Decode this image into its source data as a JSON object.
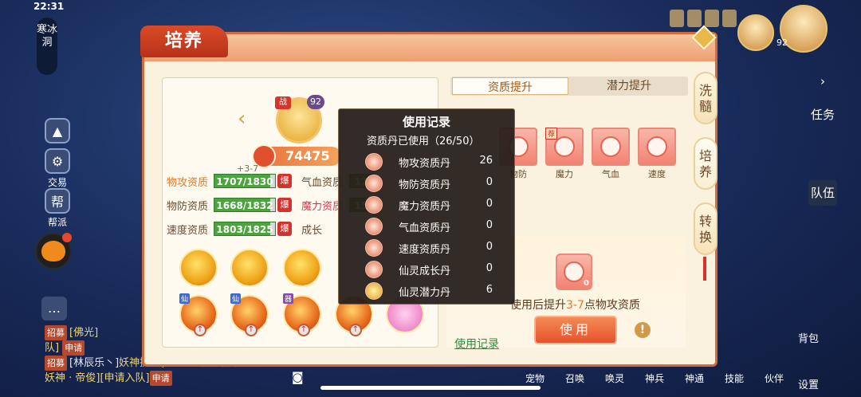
{
  "status": {
    "time": "22:31"
  },
  "location": "寒冰洞",
  "left_tools": [
    {
      "label": "交易",
      "icon": "trade-icon"
    },
    {
      "label": "帮派",
      "icon": "guild-icon"
    }
  ],
  "chat": {
    "line1_tag": "招募",
    "line1_name": "[佛光]",
    "line1_team": "队]",
    "line1_apply": "申请",
    "line2_tag": "招募",
    "line2_text": "[林辰乐丶]",
    "line2_highlight": "妖神挑战(4/5/69级 无限制0星",
    "line3_text": "妖神 · 帝俊][申请入队]",
    "line3_apply": "申请"
  },
  "right_side": {
    "task_label": "任务",
    "team_label": "队伍",
    "pack_label": "背包",
    "settings_label": "设置",
    "portrait_level": "92"
  },
  "bottom_nav": [
    "宠物",
    "召唤",
    "唤灵",
    "神兵",
    "神通",
    "技能",
    "伙伴",
    "设置"
  ],
  "panel": {
    "title": "培养",
    "side_tabs": [
      "洗髓",
      "培养",
      "转换"
    ],
    "hero": {
      "badge": "战",
      "level": "92",
      "stars": "★★★★★",
      "power": "74475",
      "plus_range": "+3-7"
    },
    "stats": [
      {
        "label": "物攻资质",
        "value": "1707/1830",
        "burst": "爆"
      },
      {
        "label": "气血资质",
        "value": "17",
        "burst": ""
      },
      {
        "label": "物防资质",
        "value": "1668/1832",
        "burst": "爆"
      },
      {
        "label": "魔力资质",
        "value": "15",
        "burst": ""
      },
      {
        "label": "速度资质",
        "value": "1803/1825",
        "burst": "爆"
      },
      {
        "label": "成长",
        "value": "",
        "burst": ""
      }
    ],
    "skill_badges": {
      "xian": "仙",
      "qi": "器"
    },
    "tabs": {
      "active": "资质提升",
      "inactive": "潜力提升"
    },
    "items": [
      {
        "label": "物防",
        "tag": ""
      },
      {
        "label": "魔力",
        "tag": "荐"
      },
      {
        "label": "气血",
        "tag": ""
      },
      {
        "label": "速度",
        "tag": ""
      }
    ],
    "use_item_count": "0",
    "use_desc_prefix": "使用后提升",
    "use_desc_value": "3-7",
    "use_desc_suffix": "点物攻资质",
    "use_button": "使用",
    "use_record_link": "使用记录"
  },
  "popup": {
    "title": "使用记录",
    "subtitle": "资质丹已使用（26/50）",
    "rows": [
      {
        "name": "物攻资质丹",
        "value": "26"
      },
      {
        "name": "物防资质丹",
        "value": "0"
      },
      {
        "name": "魔力资质丹",
        "value": "0"
      },
      {
        "name": "气血资质丹",
        "value": "0"
      },
      {
        "name": "速度资质丹",
        "value": "0"
      },
      {
        "name": "仙灵成长丹",
        "value": "0"
      },
      {
        "name": "仙灵潜力丹",
        "value": "6"
      }
    ]
  },
  "colors": {
    "accent": "#e6532c",
    "panel_bg": "#faf1df",
    "bar_green": "#4da33e",
    "link_green": "#2f8f3a"
  }
}
